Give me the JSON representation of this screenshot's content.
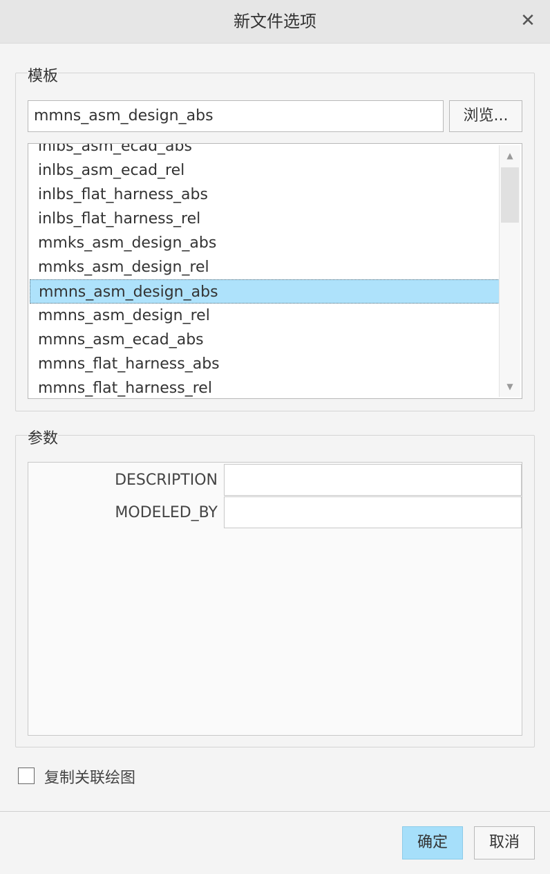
{
  "title": "新文件选项",
  "close_icon": "close-icon",
  "template": {
    "group_label": "模板",
    "selected_value": "mmns_asm_design_abs",
    "browse_label": "浏览...",
    "items": [
      "inlbs_asm_ecad_abs",
      "inlbs_asm_ecad_rel",
      "inlbs_flat_harness_abs",
      "inlbs_flat_harness_rel",
      "mmks_asm_design_abs",
      "mmks_asm_design_rel",
      "mmns_asm_design_abs",
      "mmns_asm_design_rel",
      "mmns_asm_ecad_abs",
      "mmns_flat_harness_abs",
      "mmns_flat_harness_rel"
    ],
    "selected_index": 6
  },
  "params": {
    "group_label": "参数",
    "rows": [
      {
        "label": "DESCRIPTION",
        "value": ""
      },
      {
        "label": "MODELED_BY",
        "value": ""
      }
    ]
  },
  "copy_drawing": {
    "label": "复制关联绘图",
    "checked": false
  },
  "footer": {
    "ok_label": "确定",
    "cancel_label": "取消"
  },
  "colors": {
    "selection": "#aee2fb",
    "primary_button": "#a6dffa"
  }
}
